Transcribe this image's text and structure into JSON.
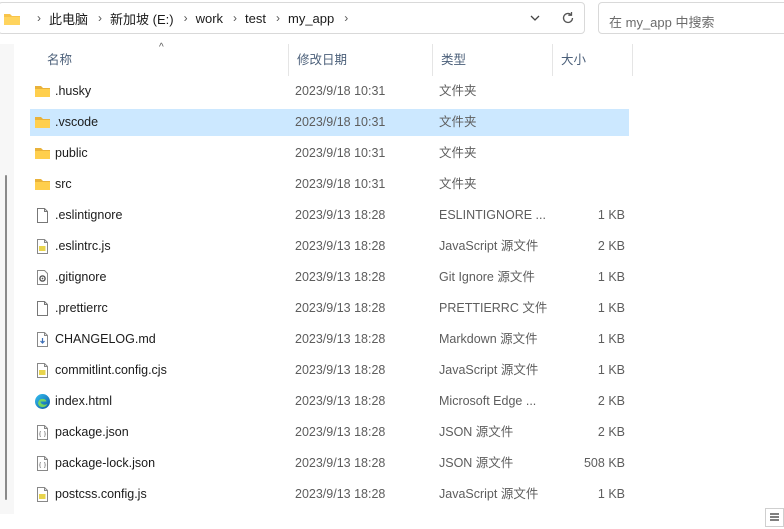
{
  "address": {
    "breadcrumbs": [
      "此电脑",
      "新加坡 (E:)",
      "work",
      "test",
      "my_app"
    ]
  },
  "search": {
    "placeholder": "在 my_app 中搜索"
  },
  "columns": {
    "name": "名称",
    "modified": "修改日期",
    "type": "类型",
    "size": "大小"
  },
  "files": [
    {
      "name": ".husky",
      "date": "2023/9/18 10:31",
      "type": "文件夹",
      "size": "",
      "icon": "folder-icon"
    },
    {
      "name": ".vscode",
      "date": "2023/9/18 10:31",
      "type": "文件夹",
      "size": "",
      "icon": "folder-icon",
      "selected": true
    },
    {
      "name": "public",
      "date": "2023/9/18 10:31",
      "type": "文件夹",
      "size": "",
      "icon": "folder-icon"
    },
    {
      "name": "src",
      "date": "2023/9/18 10:31",
      "type": "文件夹",
      "size": "",
      "icon": "folder-icon"
    },
    {
      "name": ".eslintignore",
      "date": "2023/9/13 18:28",
      "type": "ESLINTIGNORE ...",
      "size": "1 KB",
      "icon": "file-icon"
    },
    {
      "name": ".eslintrc.js",
      "date": "2023/9/13 18:28",
      "type": "JavaScript 源文件",
      "size": "2 KB",
      "icon": "js-file-icon"
    },
    {
      "name": ".gitignore",
      "date": "2023/9/13 18:28",
      "type": "Git Ignore 源文件",
      "size": "1 KB",
      "icon": "gear-file-icon"
    },
    {
      "name": ".prettierrc",
      "date": "2023/9/13 18:28",
      "type": "PRETTIERRC 文件",
      "size": "1 KB",
      "icon": "file-icon"
    },
    {
      "name": "CHANGELOG.md",
      "date": "2023/9/13 18:28",
      "type": "Markdown 源文件",
      "size": "1 KB",
      "icon": "md-file-icon"
    },
    {
      "name": "commitlint.config.cjs",
      "date": "2023/9/13 18:28",
      "type": "JavaScript 源文件",
      "size": "1 KB",
      "icon": "js-file-icon"
    },
    {
      "name": "index.html",
      "date": "2023/9/13 18:28",
      "type": "Microsoft Edge ...",
      "size": "2 KB",
      "icon": "edge-icon"
    },
    {
      "name": "package.json",
      "date": "2023/9/13 18:28",
      "type": "JSON 源文件",
      "size": "2 KB",
      "icon": "json-file-icon"
    },
    {
      "name": "package-lock.json",
      "date": "2023/9/13 18:28",
      "type": "JSON 源文件",
      "size": "508 KB",
      "icon": "json-file-icon"
    },
    {
      "name": "postcss.config.js",
      "date": "2023/9/13 18:28",
      "type": "JavaScript 源文件",
      "size": "1 KB",
      "icon": "js-file-icon"
    }
  ]
}
